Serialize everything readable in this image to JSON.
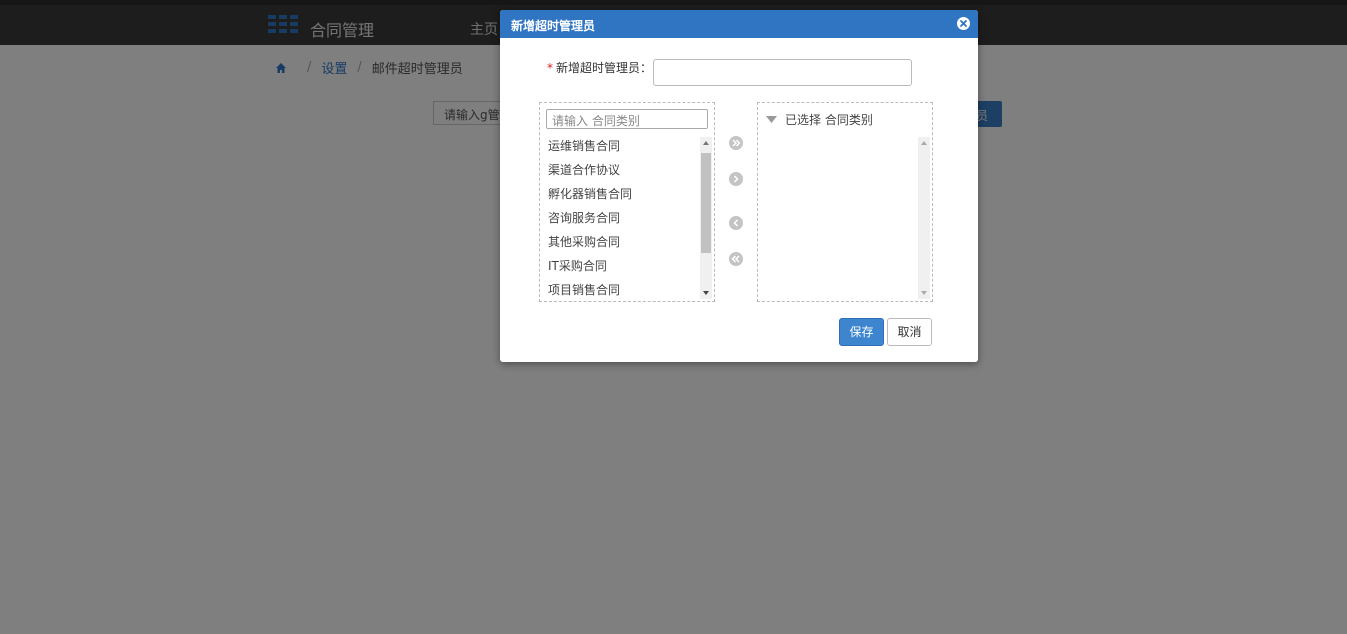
{
  "app": {
    "title": "合同管理",
    "nav_home": "主页"
  },
  "breadcrumb": {
    "items": [
      "设置",
      "邮件超时管理员"
    ]
  },
  "background": {
    "search_text": "请输入g管",
    "button_text": "员"
  },
  "modal": {
    "title": "新增超时管理员",
    "field_label": "新增超时管理员：",
    "field_value": "",
    "left_panel": {
      "search_placeholder": "请输入 合同类别",
      "items": [
        "运维销售合同",
        "渠道合作协议",
        "孵化器销售合同",
        "咨询服务合同",
        "其他采购合同",
        "IT采购合同",
        "项目销售合同"
      ]
    },
    "right_panel": {
      "header": "已选择 合同类别"
    },
    "save_label": "保存",
    "cancel_label": "取消"
  },
  "colors": {
    "accent": "#2f75c2",
    "required": "#e02020"
  }
}
